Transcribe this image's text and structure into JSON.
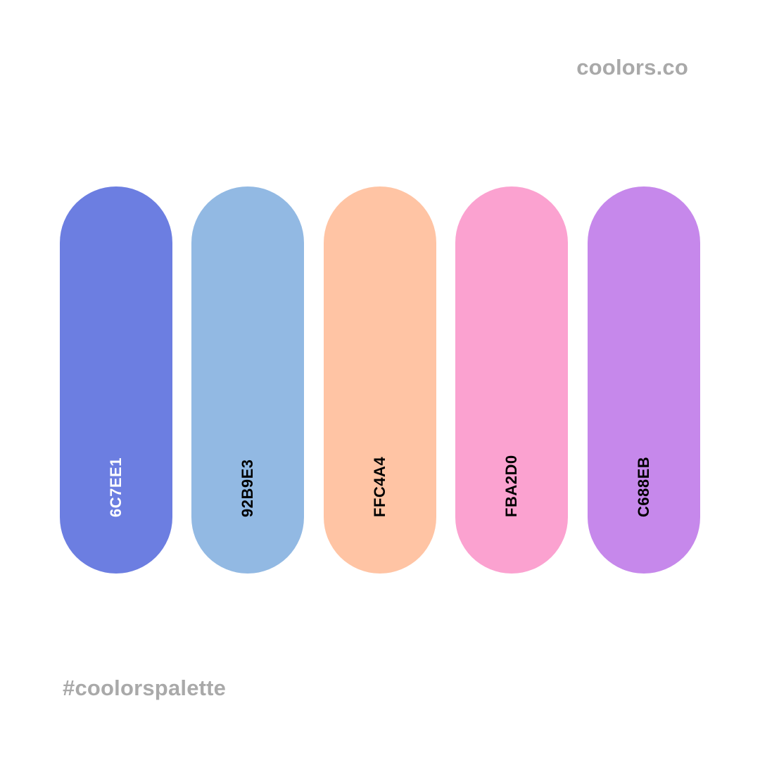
{
  "brand": "coolors.co",
  "hashtag": "#coolorspalette",
  "swatches": [
    {
      "hex": "6C7EE1",
      "color": "#6C7EE1",
      "text_color": "#ffffff"
    },
    {
      "hex": "92B9E3",
      "color": "#92B9E3",
      "text_color": "#000000"
    },
    {
      "hex": "FFC4A4",
      "color": "#FFC4A4",
      "text_color": "#000000"
    },
    {
      "hex": "FBA2D0",
      "color": "#FBA2D0",
      "text_color": "#000000"
    },
    {
      "hex": "C688EB",
      "color": "#C688EB",
      "text_color": "#000000"
    }
  ]
}
